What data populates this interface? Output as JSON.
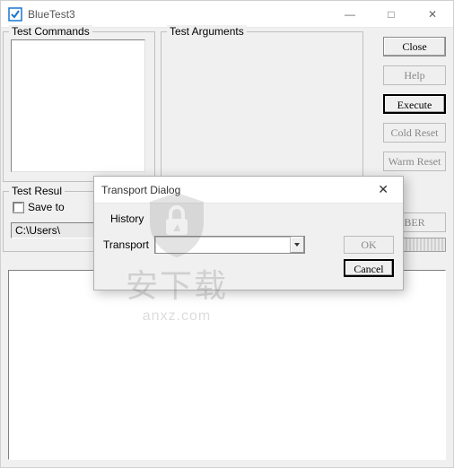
{
  "app": {
    "title": "BlueTest3"
  },
  "window_controls": {
    "minimize": "—",
    "maximize": "□",
    "close": "✕"
  },
  "groups": {
    "commands_label": "Test Commands",
    "arguments_label": "Test Arguments",
    "results_label": "Test Resul"
  },
  "buttons": {
    "close": "Close",
    "help": "Help",
    "execute": "Execute",
    "cold_reset": "Cold Reset",
    "warm_reset": "Warm Reset",
    "ber": "BER"
  },
  "results": {
    "save_checkbox": "Save to",
    "path": "C:\\Users\\"
  },
  "dialog": {
    "title": "Transport Dialog",
    "history": "History",
    "transport_label": "Transport",
    "transport_value": "",
    "ok": "OK",
    "cancel": "Cancel",
    "close_glyph": "✕"
  },
  "watermark": {
    "text": "安下载",
    "url": "anxz.com"
  }
}
